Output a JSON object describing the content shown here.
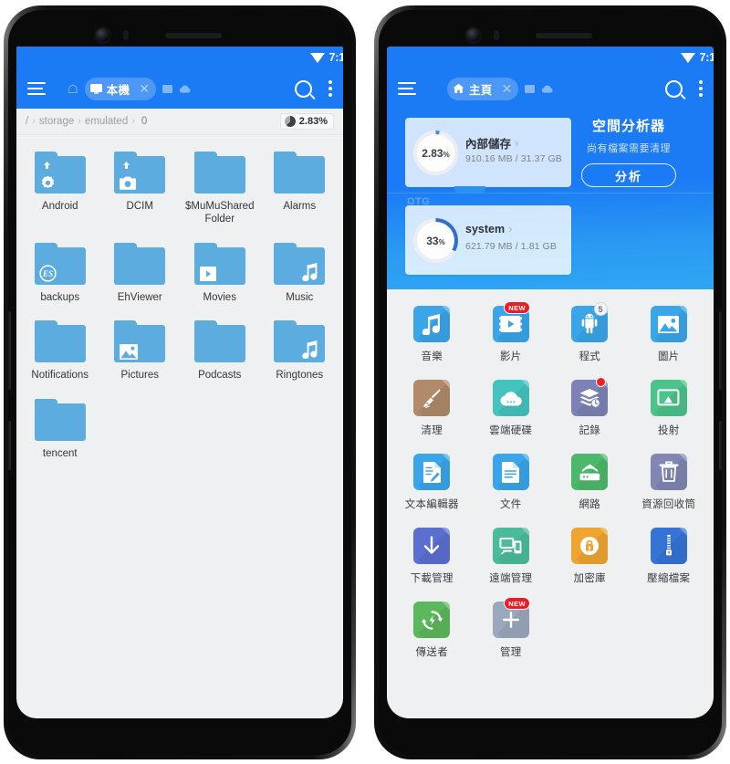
{
  "left_phone": {
    "status_bar": {
      "time": "7:1",
      "wifi_icon": "wifi-icon"
    },
    "appbar": {
      "menu_icon": "hamburger-menu-icon",
      "home_icon": "home-icon",
      "tab": {
        "icon": "device-icon",
        "label": "本機",
        "close": "✕"
      },
      "mini_icons": [
        "window-icon",
        "cloud-icon"
      ],
      "search_icon": "search-icon",
      "overflow_icon": "kebab-menu-icon"
    },
    "breadcrumb": {
      "segments": [
        "/",
        "storage",
        "emulated",
        "0"
      ],
      "usage_badge": {
        "icon": "pie-chart-icon",
        "value": "2.83%"
      }
    },
    "folders": [
      {
        "name": "Android",
        "glyph": "uparrow-gear"
      },
      {
        "name": "DCIM",
        "glyph": "uparrow-camera"
      },
      {
        "name": "$MuMuShared Folder",
        "glyph": "plain"
      },
      {
        "name": "Alarms",
        "glyph": "plain"
      },
      {
        "name": "backups",
        "glyph": "es-logo"
      },
      {
        "name": "EhViewer",
        "glyph": "plain"
      },
      {
        "name": "Movies",
        "glyph": "play"
      },
      {
        "name": "Music",
        "glyph": "music"
      },
      {
        "name": "Notifications",
        "glyph": "plain"
      },
      {
        "name": "Pictures",
        "glyph": "picture"
      },
      {
        "name": "Podcasts",
        "glyph": "plain"
      },
      {
        "name": "Ringtones",
        "glyph": "music2"
      },
      {
        "name": "tencent",
        "glyph": "plain"
      }
    ]
  },
  "right_phone": {
    "status_bar": {
      "time": "7:1",
      "wifi_icon": "wifi-icon"
    },
    "appbar": {
      "menu_icon": "hamburger-menu-icon",
      "tab": {
        "icon": "home-icon",
        "label": "主頁",
        "close": "✕"
      },
      "mini_icons": [
        "window-icon",
        "cloud-icon"
      ],
      "search_icon": "search-icon",
      "overflow_icon": "kebab-menu-icon"
    },
    "storage_cards": [
      {
        "name": "內部儲存",
        "arrow": "›",
        "percent": "2.83",
        "percent_unit": "%",
        "detail": "910.16 MB / 31.37 GB",
        "ring_pct": 2.83,
        "ring_color": "#3f8cf0"
      },
      {
        "name": "system",
        "arrow": "›",
        "percent": "33",
        "percent_unit": "%",
        "detail": "621.79 MB / 1.81 GB",
        "ring_pct": 33,
        "ring_color": "#2f6fd0",
        "ghost_label": "OTG"
      }
    ],
    "analyzer": {
      "title": "空間分析器",
      "subtitle": "尚有檔案需要清理",
      "button": "分析"
    },
    "apps": [
      {
        "label": "音樂",
        "icon": "music-note-icon",
        "color": "#3aa5e8",
        "badge": null,
        "badge_text": ""
      },
      {
        "label": "影片",
        "icon": "video-play-icon",
        "color": "#3aa5e8",
        "badge": "new",
        "badge_text": "NEW"
      },
      {
        "label": "程式",
        "icon": "android-robot-icon",
        "color": "#3aa5e8",
        "badge": "count",
        "badge_text": "5"
      },
      {
        "label": "圖片",
        "icon": "photo-icon",
        "color": "#3aa5e8",
        "badge": null,
        "badge_text": ""
      },
      {
        "label": "清理",
        "icon": "broom-icon",
        "color": "#b08a6b",
        "badge": null,
        "badge_text": ""
      },
      {
        "label": "雲端硬碟",
        "icon": "cloud-drive-icon",
        "color": "#45c3bf",
        "badge": null,
        "badge_text": ""
      },
      {
        "label": "記錄",
        "icon": "layers-clock-icon",
        "color": "#7c82b5",
        "badge": "dot",
        "badge_text": ""
      },
      {
        "label": "投射",
        "icon": "cast-screen-icon",
        "color": "#4cc38a",
        "badge": null,
        "badge_text": ""
      },
      {
        "label": "文本編輯器",
        "icon": "text-editor-icon",
        "color": "#3aa5e8",
        "badge": null,
        "badge_text": ""
      },
      {
        "label": "文件",
        "icon": "document-icon",
        "color": "#3aa5e8",
        "badge": null,
        "badge_text": ""
      },
      {
        "label": "網路",
        "icon": "router-wifi-icon",
        "color": "#4cb96a",
        "badge": null,
        "badge_text": ""
      },
      {
        "label": "資源回收筒",
        "icon": "trash-bin-icon",
        "color": "#8186b4",
        "badge": null,
        "badge_text": ""
      },
      {
        "label": "下載管理",
        "icon": "download-arrow-icon",
        "color": "#5b6fd0",
        "badge": null,
        "badge_text": ""
      },
      {
        "label": "遠端管理",
        "icon": "remote-devices-icon",
        "color": "#4cbb9a",
        "badge": null,
        "badge_text": ""
      },
      {
        "label": "加密庫",
        "icon": "lock-shield-icon",
        "color": "#f0a430",
        "badge": null,
        "badge_text": ""
      },
      {
        "label": "壓縮檔案",
        "icon": "zip-archive-icon",
        "color": "#3573d6",
        "badge": null,
        "badge_text": ""
      },
      {
        "label": "傳送者",
        "icon": "transfer-sync-icon",
        "color": "#5cb85c",
        "badge": null,
        "badge_text": ""
      },
      {
        "label": "管理",
        "icon": "plus-add-icon",
        "color": "#99a8bc",
        "badge": "new",
        "badge_text": "NEW"
      }
    ]
  }
}
